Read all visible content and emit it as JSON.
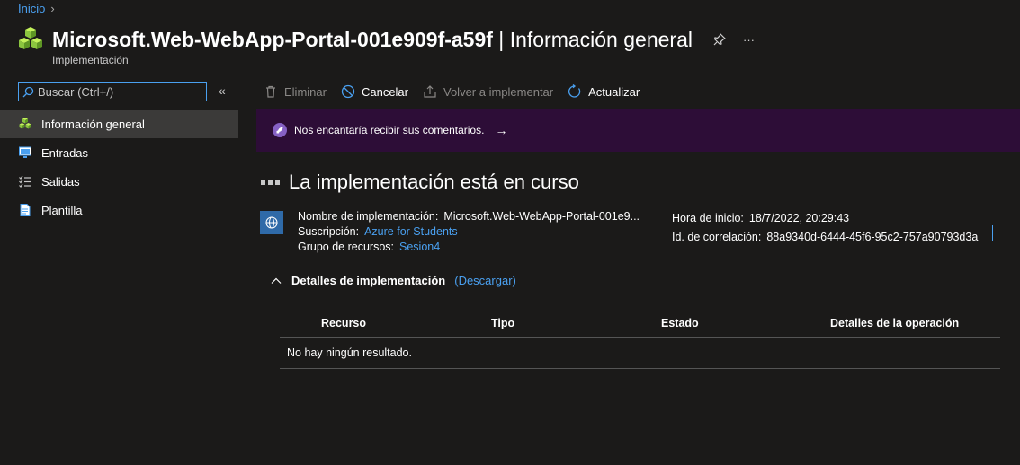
{
  "breadcrumb": {
    "home": "Inicio"
  },
  "header": {
    "title_main": "Microsoft.Web-WebApp-Portal-001e909f-a59f",
    "title_sep": " | ",
    "title_section": "Información general",
    "subtitle": "Implementación",
    "more": "···"
  },
  "search": {
    "placeholder": "Buscar (Ctrl+/)",
    "collapse": "«"
  },
  "sidebar": {
    "items": [
      {
        "label": "Información general",
        "icon": "overview-icon",
        "active": true
      },
      {
        "label": "Entradas",
        "icon": "inputs-icon"
      },
      {
        "label": "Salidas",
        "icon": "outputs-icon"
      },
      {
        "label": "Plantilla",
        "icon": "template-icon"
      }
    ]
  },
  "toolbar": {
    "delete": "Eliminar",
    "cancel": "Cancelar",
    "redeploy": "Volver a implementar",
    "refresh": "Actualizar"
  },
  "banner": {
    "text": "Nos encantaría recibir sus comentarios.",
    "arrow": "→"
  },
  "status": {
    "heading": "La implementación está en curso"
  },
  "info": {
    "name_label": "Nombre de implementación:",
    "name_value": "Microsoft.Web-WebApp-Portal-001e9...",
    "subscription_label": "Suscripción:",
    "subscription_value": "Azure for Students",
    "resource_group_label": "Grupo de recursos:",
    "resource_group_value": "Sesion4",
    "start_label": "Hora de inicio:",
    "start_value": "18/7/2022, 20:29:43",
    "correlation_label": "Id. de correlación:",
    "correlation_value": "88a9340d-6444-45f6-95c2-757a90793d3a"
  },
  "details": {
    "title": "Detalles de implementación",
    "download": "(Descargar)",
    "columns": [
      "Recurso",
      "Tipo",
      "Estado",
      "Detalles de la operación"
    ],
    "empty": "No hay ningún resultado."
  },
  "colors": {
    "accent": "#4aa0f0",
    "banner_bg": "#2d0d37",
    "bg": "#1b1a19"
  }
}
